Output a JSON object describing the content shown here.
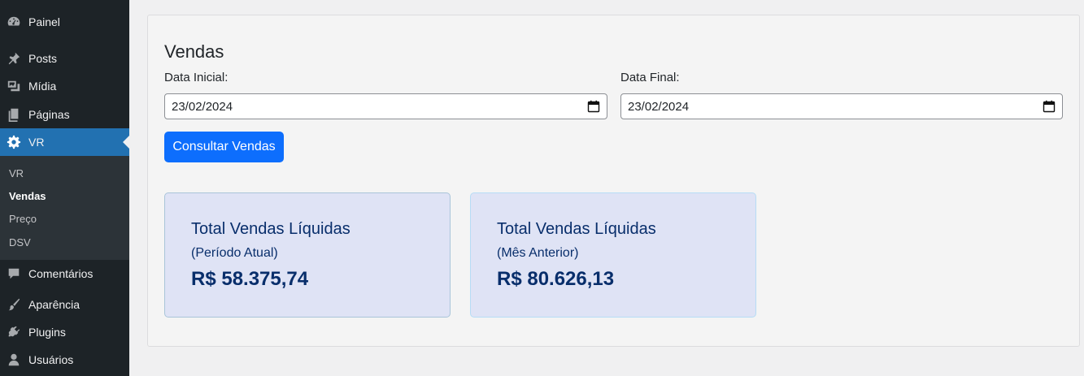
{
  "sidebar": {
    "items": [
      {
        "label": "Painel",
        "icon": "dashboard-icon"
      },
      {
        "label": "Posts",
        "icon": "pin-icon"
      },
      {
        "label": "Mídia",
        "icon": "media-icon"
      },
      {
        "label": "Páginas",
        "icon": "pages-icon"
      },
      {
        "label": "VR",
        "icon": "gear-icon",
        "active": true
      },
      {
        "label": "Comentários",
        "icon": "comment-icon"
      },
      {
        "label": "Aparência",
        "icon": "brush-icon"
      },
      {
        "label": "Plugins",
        "icon": "plug-icon"
      },
      {
        "label": "Usuários",
        "icon": "user-icon"
      }
    ],
    "submenu": [
      {
        "label": "VR"
      },
      {
        "label": "Vendas",
        "current": true
      },
      {
        "label": "Preço"
      },
      {
        "label": "DSV"
      }
    ]
  },
  "main": {
    "title": "Vendas",
    "start_label": "Data Inicial:",
    "start_value": "23/02/2024",
    "end_label": "Data Final:",
    "end_value": "23/02/2024",
    "button_label": "Consultar Vendas",
    "cards": [
      {
        "title": "Total Vendas Líquidas",
        "subtitle": "(Período Atual)",
        "value": "R$ 58.375,74"
      },
      {
        "title": "Total Vendas Líquidas",
        "subtitle": "(Mês Anterior)",
        "value": "R$ 80.626,13"
      }
    ]
  },
  "colors": {
    "sidebar_bg": "#1d2327",
    "active_bg": "#2271b1",
    "button_bg": "#0d6efd",
    "card_bg": "#dfe3f5",
    "card_text": "#082e6b"
  }
}
